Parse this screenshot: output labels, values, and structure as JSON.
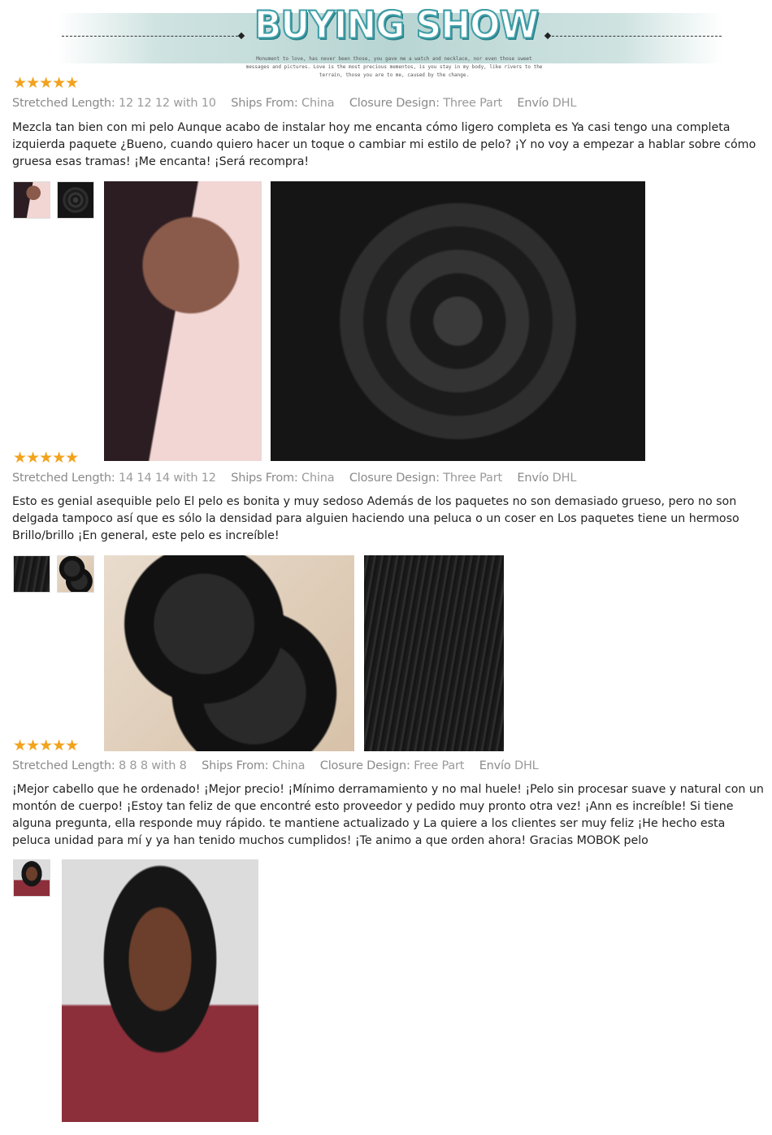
{
  "banner": {
    "title": "BUYING SHOW",
    "subtitle": "Monument to love, has never been those, you gave me a watch and necklace, nor even those sweet messages and pictures. Love is the most precious mementos, is you stay in my body, like rivers to the terrain, those you are to me, caused by the change."
  },
  "stars_glyph": "★★★★★",
  "reviews": [
    {
      "length_label": "Stretched Length:",
      "length_value": "12 12 12 with 10",
      "ships_label": "Ships From:",
      "ships_value": "China",
      "closure_label": "Closure Design:",
      "closure_value": "Three Part",
      "envio_label": "Envío",
      "envio_value": "DHL",
      "text": "Mezcla tan bien con mi pelo Aunque acabo de instalar hoy me encanta cómo ligero completa es Ya casi tengo una completa izquierda paquete ¿Bueno, cuando quiero hacer un toque o cambiar mi estilo de pelo? ¡Y no voy a empezar a hablar sobre cómo gruesa esas tramas! ¡Me encanta! ¡Será recompra!"
    },
    {
      "length_label": "Stretched Length:",
      "length_value": "14 14 14 with 12",
      "ships_label": "Ships From:",
      "ships_value": "China",
      "closure_label": "Closure Design:",
      "closure_value": "Three Part",
      "envio_label": "Envío",
      "envio_value": "DHL",
      "text": "Esto es genial asequible pelo El pelo es bonita y muy sedoso Además de los paquetes no son demasiado grueso, pero no son delgada tampoco así que es sólo la densidad para alguien haciendo una peluca o un coser en Los paquetes tiene un hermoso Brillo/brillo ¡En general, este pelo es increíble!"
    },
    {
      "length_label": "Stretched Length:",
      "length_value": "8 8 8 with 8",
      "ships_label": "Ships From:",
      "ships_value": "China",
      "closure_label": "Closure Design:",
      "closure_value": "Free Part",
      "envio_label": "Envío",
      "envio_value": "DHL",
      "text": "¡Mejor cabello que he ordenado! ¡Mejor precio! ¡Mínimo derramamiento y no mal huele! ¡Pelo sin procesar suave y natural con un montón de cuerpo! ¡Estoy tan feliz de que encontré esto proveedor y pedido muy pronto otra vez! ¡Ann es increíble! Si tiene alguna pregunta, ella responde muy rápido. te mantiene actualizado y La quiere a los clientes ser muy feliz ¡He hecho esta peluca unidad para mí y ya han tenido muchos cumplidos! ¡Te animo a que orden ahora! Gracias MOBOK pelo"
    }
  ],
  "colors": {
    "star": "#f3a21d",
    "banner_teal": "#3f9fa8",
    "label_gray": "#8a8a8a"
  }
}
